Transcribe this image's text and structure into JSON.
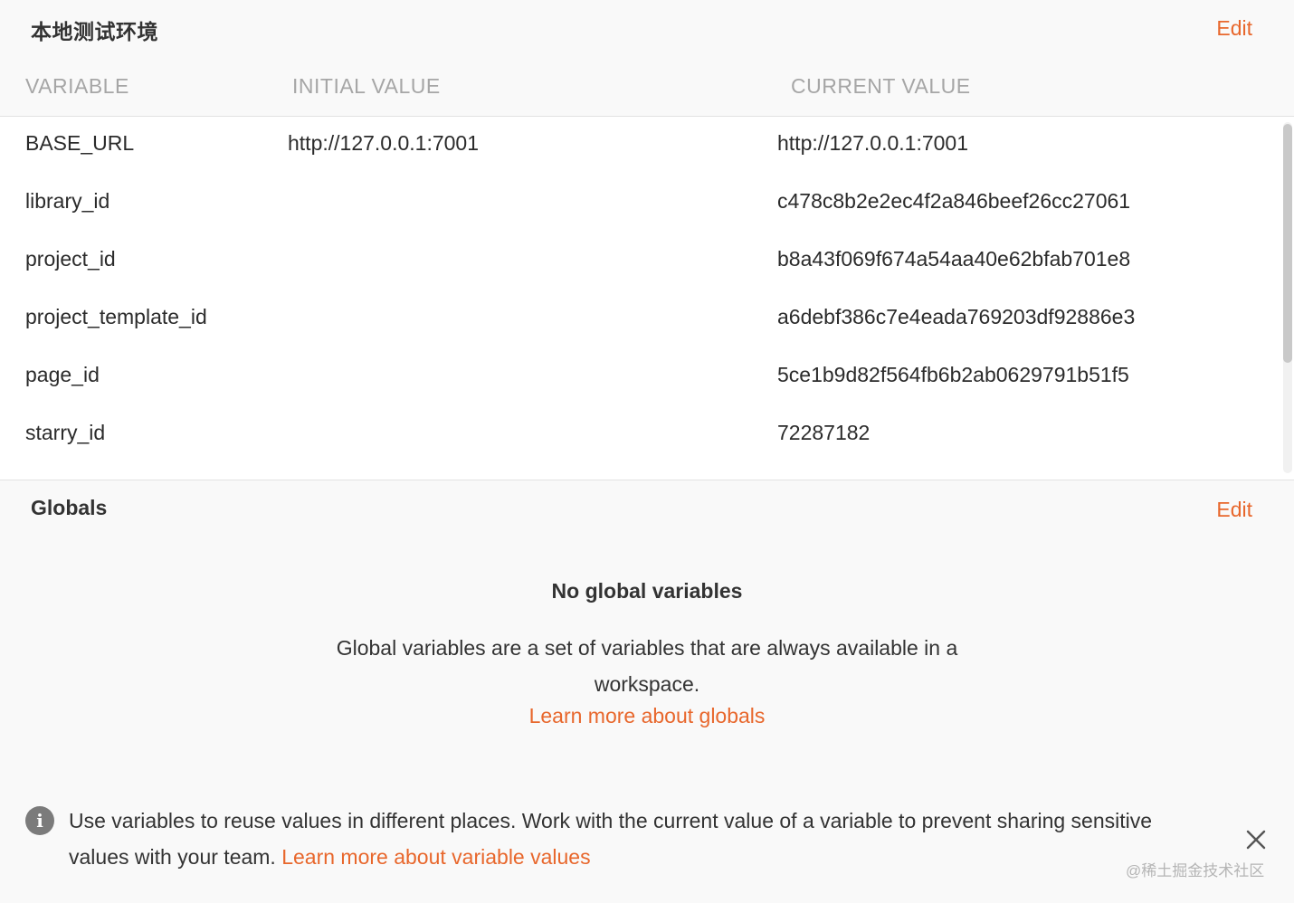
{
  "environment": {
    "title": "本地测试环境",
    "edit_label": "Edit",
    "columns": {
      "variable": "VARIABLE",
      "initial": "INITIAL VALUE",
      "current": "CURRENT VALUE"
    },
    "rows": [
      {
        "name": "BASE_URL",
        "initial": "http://127.0.0.1:7001",
        "current": "http://127.0.0.1:7001"
      },
      {
        "name": "library_id",
        "initial": "",
        "current": "c478c8b2e2ec4f2a846beef26cc27061"
      },
      {
        "name": "project_id",
        "initial": "",
        "current": "b8a43f069f674a54aa40e62bfab701e8"
      },
      {
        "name": "project_template_id",
        "initial": "",
        "current": "a6debf386c7e4eada769203df92886e3"
      },
      {
        "name": "page_id",
        "initial": "",
        "current": "5ce1b9d82f564fb6b2ab0629791b51f5"
      },
      {
        "name": "starry_id",
        "initial": "",
        "current": "72287182"
      }
    ]
  },
  "globals": {
    "title": "Globals",
    "edit_label": "Edit",
    "empty_title": "No global variables",
    "empty_description": "Global variables are a set of variables that are always available in a workspace.",
    "learn_more": "Learn more about globals"
  },
  "info_banner": {
    "icon": "info-icon",
    "text": "Use variables to reuse values in different places. Work with the current value of a variable to prevent sharing sensitive values with your team. ",
    "link": "Learn more about variable values",
    "close_icon": "close-icon"
  },
  "watermark": "@稀土掘金技术社区",
  "colors": {
    "accent": "#e8672c",
    "header_text": "#a6a6a6",
    "background": "#f9f9f9",
    "table_background": "#ffffff"
  }
}
